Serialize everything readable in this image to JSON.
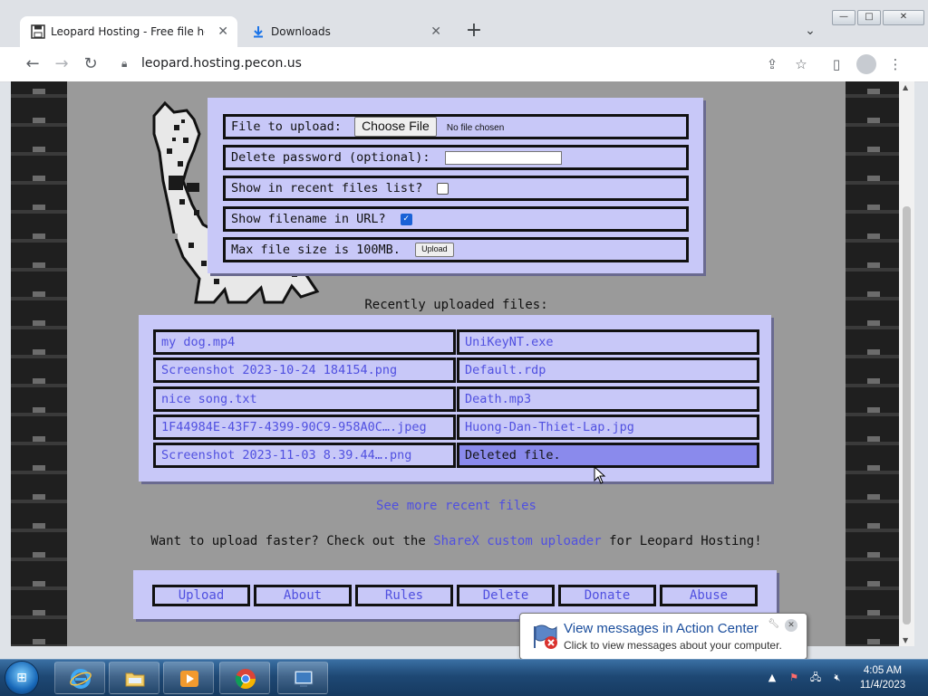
{
  "browser": {
    "tabs": [
      {
        "label": "Leopard Hosting - Free file hostin",
        "icon": "floppy-disk-icon",
        "active": true
      },
      {
        "label": "Downloads",
        "icon": "download-icon",
        "active": false
      }
    ],
    "new_tab_symbol": "+",
    "tab_close_symbol": "✕",
    "address": {
      "url": "leopard.hosting.pecon.us"
    },
    "window_controls": {
      "minimize": "—",
      "maximize": "□",
      "close": "✕"
    }
  },
  "upload_form": {
    "file_label": "File to upload:",
    "choose_button": "Choose File",
    "no_file_text": "No file chosen",
    "password_label": "Delete password (optional):",
    "password_value": "",
    "recent_label": "Show in recent files list?",
    "recent_checked": false,
    "filename_label": "Show filename in URL?",
    "filename_checked": true,
    "maxsize_label": "Max file size is 100MB.",
    "upload_button": "Upload"
  },
  "recent": {
    "title": "Recently uploaded files:",
    "left_files": [
      "my dog.mp4",
      "Screenshot 2023-10-24 184154.png",
      "nice song.txt",
      "1F44984E-43F7-4399-90C9-958A0C….jpeg",
      "Screenshot 2023-11-03 8.39.44….png"
    ],
    "right_files": [
      "UniKeyNT.exe",
      "Default.rdp",
      "Death.mp3",
      "Huong-Dan-Thiet-Lap.jpg",
      "Deleted file."
    ],
    "see_more": "See more recent files"
  },
  "sharex": {
    "before": "Want to upload faster? Check out the",
    "link": "ShareX custom uploader",
    "after": "for Leopard Hosting!"
  },
  "nav_links": [
    "Upload",
    "About",
    "Rules",
    "Delete",
    "Donate",
    "Abuse"
  ],
  "notification": {
    "title": "View messages in Action Center",
    "text": "Click to view messages about your computer."
  },
  "taskbar": {
    "apps": [
      "internet-explorer",
      "file-explorer",
      "media-player",
      "chrome",
      "remote-desktop"
    ],
    "clock_time": "4:05 AM",
    "clock_date": "11/4/2023"
  },
  "colors": {
    "panel": "#c8c8f8",
    "link": "#5050e0",
    "page_bg": "#9a9a9a",
    "deleted_bg": "#8a8aec"
  }
}
